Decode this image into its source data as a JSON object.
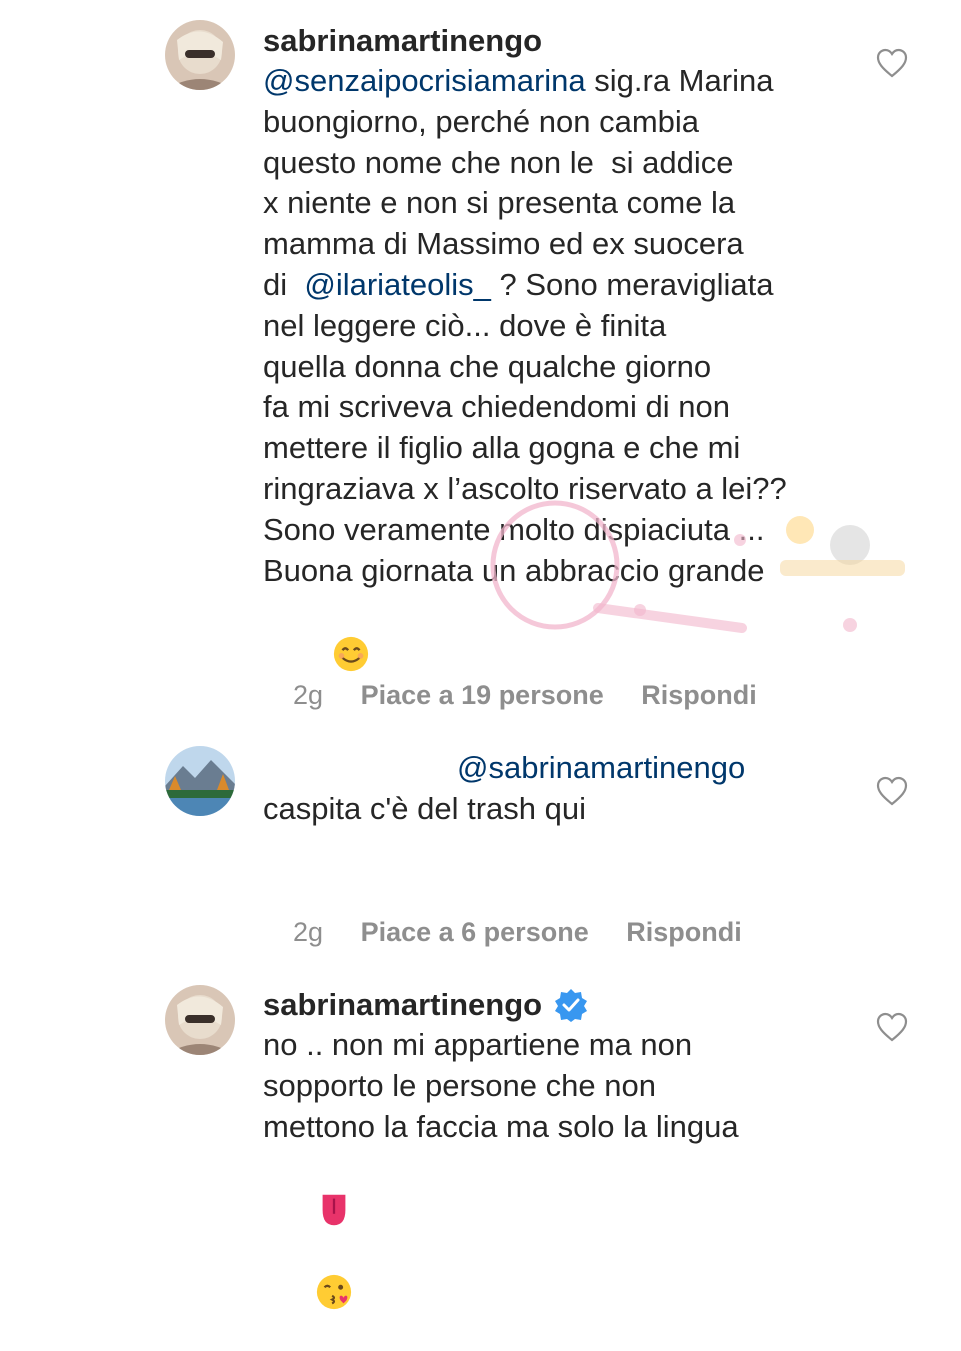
{
  "comments": [
    {
      "username": "sabrinamartinengo",
      "lines": [
        [
          "",
          "@senzaipocrisiamarina",
          " sig.ra Marina"
        ],
        [
          "buongiorno, perché non cambia",
          "",
          ""
        ],
        [
          "questo nome che non le  si addice",
          "",
          ""
        ],
        [
          "x niente e non si presenta come la",
          "",
          ""
        ],
        [
          "mamma di Massimo ed ex suocera",
          "",
          ""
        ],
        [
          "di  ",
          "@ilariateolis_",
          " ? Sono meravigliata"
        ],
        [
          "nel leggere ciò... dove è finita",
          "",
          ""
        ],
        [
          "quella donna che qualche giorno",
          "",
          ""
        ],
        [
          "fa mi scriveva chiedendomi di non",
          "",
          ""
        ],
        [
          "mettere il figlio alla gogna e che mi",
          "",
          ""
        ],
        [
          "ringraziava x l’ascolto riservato a lei??",
          "",
          ""
        ],
        [
          "Sono veramente molto dispiaciuta ...",
          "",
          ""
        ],
        [
          "Buona giornata un abbraccio grande",
          "",
          ""
        ]
      ],
      "emojis": [
        "smiling-face-emoji"
      ],
      "age": "2g",
      "likes": "Piace a 19 persone",
      "reply": "Rispondi"
    },
    {
      "username": "",
      "mention": "@sabrinamartinengo",
      "text": "caspita c'è del trash qui",
      "age": "2g",
      "likes": "Piace a 6 persone",
      "reply": "Rispondi"
    },
    {
      "username": "sabrinamartinengo",
      "verified": true,
      "lines": [
        "no .. non mi appartiene ma non",
        "sopporto le persone che non",
        "mettono la faccia ma solo la lingua"
      ],
      "emojis": [
        "tongue-emoji",
        "kissing-face-emoji"
      ]
    }
  ],
  "colors": {
    "text": "#262626",
    "mention": "#00376b",
    "meta": "#8e8e8e",
    "verified": "#3897f0"
  }
}
